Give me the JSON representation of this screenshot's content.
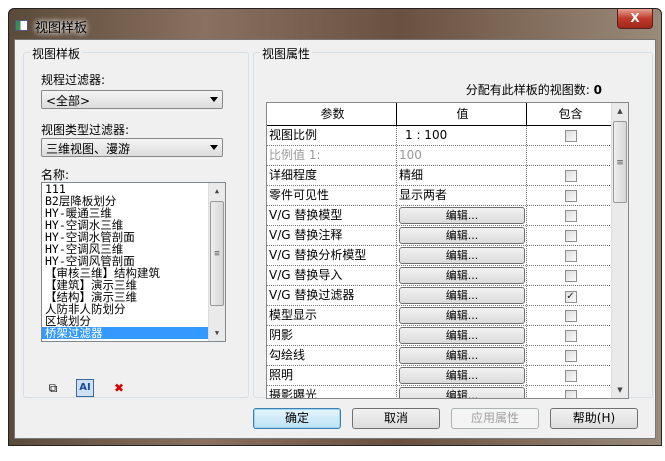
{
  "window": {
    "title": "视图样板",
    "close_label": "X"
  },
  "left": {
    "group_title": "视图样板",
    "discipline_filter_label": "规程过滤器:",
    "discipline_filter_value": "<全部>",
    "view_type_filter_label": "视图类型过滤器:",
    "view_type_filter_value": "三维视图、漫游",
    "names_label": "名称:",
    "names": [
      "111",
      "B2层降板划分",
      "HY-暖通三维",
      "HY-空调水三维",
      "HY-空调水管剖面",
      "HY-空调风三维",
      "HY-空调风管剖面",
      "【审核三维】结构建筑",
      "【建筑】演示三维",
      "【结构】演示三维",
      "人防非人防划分",
      "区域划分",
      "桥架过滤器"
    ],
    "selected_index": 12
  },
  "right": {
    "group_title": "视图属性",
    "assigned_count_label": "分配有此样板的视图数:",
    "assigned_count": "0",
    "columns": [
      "参数",
      "值",
      "包含"
    ],
    "rows": [
      {
        "param": "视图比例",
        "value": "1 : 100",
        "type": "text",
        "include": false
      },
      {
        "param": "比例值 1:",
        "value": "100",
        "type": "disabled"
      },
      {
        "param": "详细程度",
        "value": "精细",
        "type": "text",
        "include": false
      },
      {
        "param": "零件可见性",
        "value": "显示两者",
        "type": "text",
        "include": false
      },
      {
        "param": "V/G 替换模型",
        "value": "编辑...",
        "type": "button",
        "include": false
      },
      {
        "param": "V/G 替换注释",
        "value": "编辑...",
        "type": "button",
        "include": false
      },
      {
        "param": "V/G 替换分析模型",
        "value": "编辑...",
        "type": "button",
        "include": false
      },
      {
        "param": "V/G 替换导入",
        "value": "编辑...",
        "type": "button",
        "include": false
      },
      {
        "param": "V/G 替换过滤器",
        "value": "编辑...",
        "type": "button",
        "include": true
      },
      {
        "param": "模型显示",
        "value": "编辑...",
        "type": "button",
        "include": false
      },
      {
        "param": "阴影",
        "value": "编辑...",
        "type": "button",
        "include": false
      },
      {
        "param": "勾绘线",
        "value": "编辑...",
        "type": "button",
        "include": false
      },
      {
        "param": "照明",
        "value": "编辑...",
        "type": "button",
        "include": false
      },
      {
        "param": "摄影曝光",
        "value": "编辑...",
        "type": "button",
        "include": false
      }
    ]
  },
  "buttons": {
    "ok": "确定",
    "cancel": "取消",
    "apply": "应用属性",
    "help": "帮助(H)"
  },
  "checkmark": "✓"
}
